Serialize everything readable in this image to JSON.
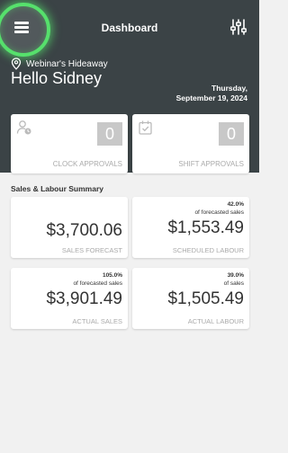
{
  "header": {
    "title": "Dashboard",
    "location": "Webinar's Hideaway",
    "greeting": "Hello Sidney",
    "date_line1": "Thursday,",
    "date_line2": "September 19, 2024"
  },
  "approvals": [
    {
      "label": "Clock Approvals",
      "count": "0",
      "icon": "user-clock-icon"
    },
    {
      "label": "Shift Approvals",
      "count": "0",
      "icon": "calendar-check-icon"
    }
  ],
  "summary": {
    "title": "Sales & Labour Summary",
    "cards": [
      {
        "label": "Sales Forecast",
        "value": "$3,700.06",
        "pct": "",
        "pct_caption": ""
      },
      {
        "label": "Scheduled Labour",
        "value": "$1,553.49",
        "pct": "42.0%",
        "pct_caption": "of forecasted sales"
      },
      {
        "label": "Actual Sales",
        "value": "$3,901.49",
        "pct": "105.0%",
        "pct_caption": "of forecasted sales"
      },
      {
        "label": "Actual Labour",
        "value": "$1,505.49",
        "pct": "39.0%",
        "pct_caption": "of sales"
      }
    ]
  },
  "colors": {
    "header_bg": "#3b4346",
    "highlight": "#56e06c",
    "page_bg": "#f1f1f1"
  }
}
